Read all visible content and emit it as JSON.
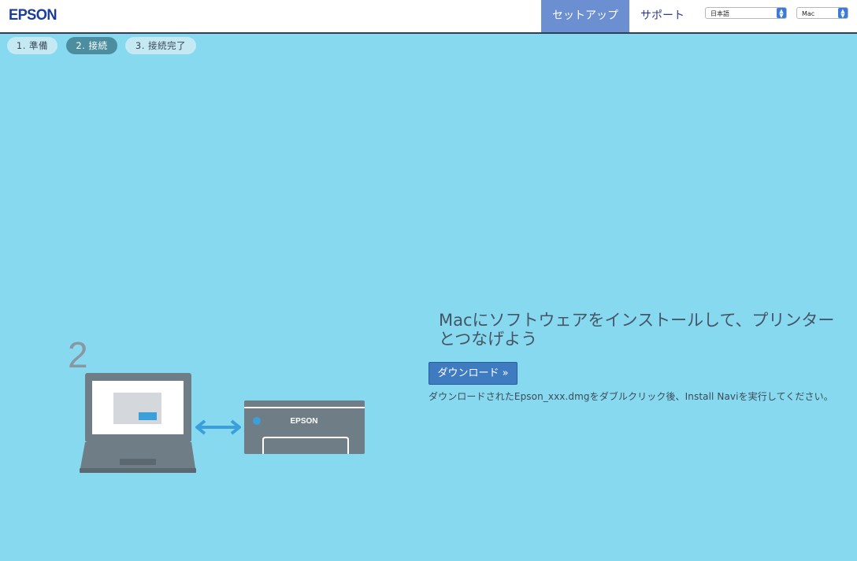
{
  "header": {
    "logo": "EPSON",
    "nav": {
      "setup_label": "セットアップ",
      "support_label": "サポート"
    },
    "language_select": {
      "selected": "日本語"
    },
    "os_select": {
      "selected": "Mac"
    }
  },
  "steps": [
    {
      "label": "1. 準備"
    },
    {
      "label": "2. 接続"
    },
    {
      "label": "3. 接続完了"
    }
  ],
  "illustration": {
    "step_number": "2",
    "printer_brand": "EPSON"
  },
  "main": {
    "headline": "Macにソフトウェアをインストールして、プリンターとつなげよう",
    "download_button": "ダウンロード »",
    "instructions": "ダウンロードされたEpson_xxx.dmgをダブルクリック後、Install Naviを実行してください。"
  },
  "colors": {
    "background": "#87d9ef",
    "accent": "#6b8fd0",
    "button": "#3f7bc1",
    "active_step": "#4c8ea0"
  }
}
